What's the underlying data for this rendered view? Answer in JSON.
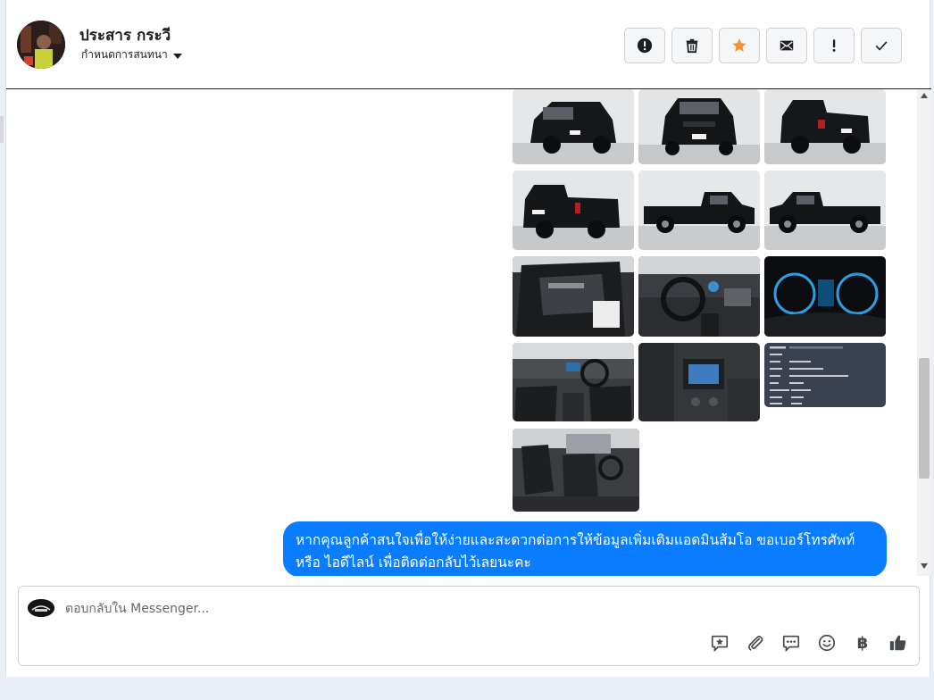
{
  "header": {
    "contact_name": "ประสาร กระวี",
    "assign_label": "กำหนดการสนทนา"
  },
  "actions": [
    {
      "name": "report-button",
      "icon": "exclamation-circle-icon"
    },
    {
      "name": "delete-button",
      "icon": "trash-icon"
    },
    {
      "name": "star-button",
      "icon": "star-icon",
      "color": "#f7923a"
    },
    {
      "name": "mark-unread-button",
      "icon": "envelope-icon"
    },
    {
      "name": "follow-up-button",
      "icon": "exclamation-icon"
    },
    {
      "name": "mark-done-button",
      "icon": "check-icon"
    }
  ],
  "gallery": {
    "images": [
      {
        "subject": "truck-front-left"
      },
      {
        "subject": "truck-front"
      },
      {
        "subject": "truck-rear-left"
      },
      {
        "subject": "truck-rear"
      },
      {
        "subject": "truck-side-right"
      },
      {
        "subject": "truck-side-left"
      },
      {
        "subject": "door-interior"
      },
      {
        "subject": "steering-dashboard"
      },
      {
        "subject": "gauge-cluster"
      },
      {
        "subject": "cabin-interior"
      },
      {
        "subject": "center-console"
      },
      {
        "subject": "registration-document"
      },
      {
        "subject": "rear-seats"
      }
    ]
  },
  "message": {
    "text": "หากคุณลูกค้าสนใจเพื่อให้ง่ายและสะดวกต่อการให้ข้อมูลเพิ่มเติมแอดมินส้มโอ ขอเบอร์โทรศัพท์ หรือ ไอดีไลน์ เพื่อติดต่อกลับไว้เลยนะคะ",
    "color": "#0a7cff"
  },
  "composer": {
    "placeholder": "ตอบกลับใน Messenger...",
    "tools": [
      "saved-reply-icon",
      "attachment-icon",
      "chat-bubble-icon",
      "emoji-icon",
      "baht-icon",
      "like-icon"
    ],
    "baht_symbol": "฿"
  }
}
